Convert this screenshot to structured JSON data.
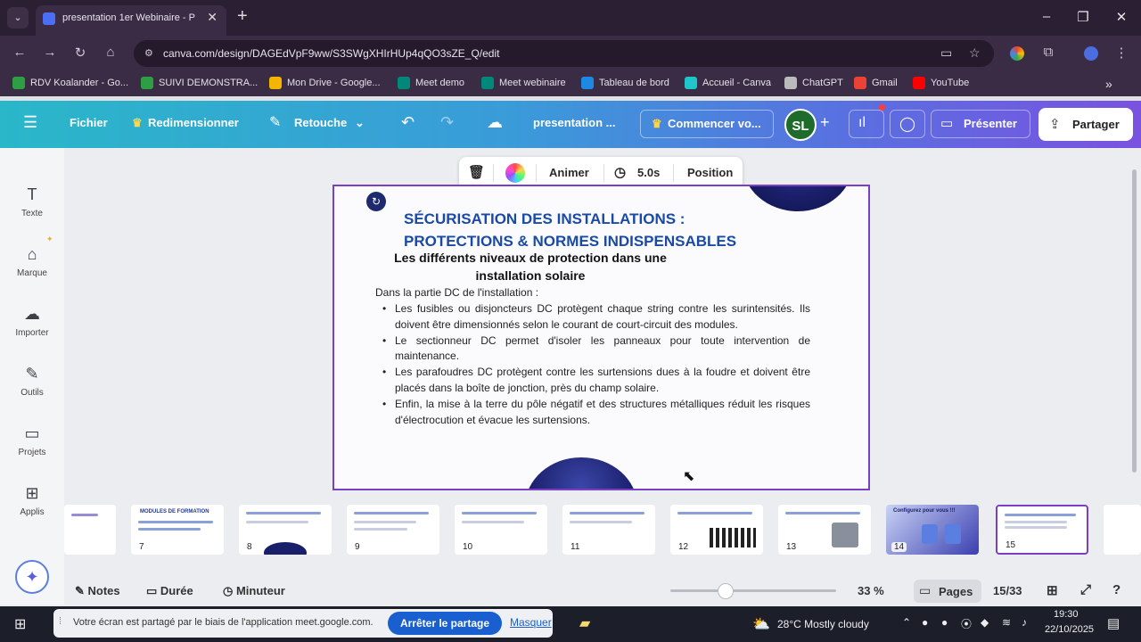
{
  "browser": {
    "tab_title": "presentation 1er Webinaire - P",
    "url": "canva.com/design/DAGEdVpF9ww/S3SWgXHIrHUp4qQO3sZE_Q/edit",
    "bookmarks": [
      {
        "label": "RDV Koalander - Go...",
        "color": "#2e9e44"
      },
      {
        "label": "SUIVI DEMONSTRA...",
        "color": "#2e9e44"
      },
      {
        "label": "Mon Drive - Google...",
        "color": "#f4b400"
      },
      {
        "label": "Meet demo",
        "color": "#00897b"
      },
      {
        "label": "Meet webinaire",
        "color": "#00897b"
      },
      {
        "label": "Tableau de bord",
        "color": "#1e88e5"
      },
      {
        "label": "Accueil - Canva",
        "color": "#20c4cb"
      },
      {
        "label": "ChatGPT",
        "color": "#bbbbbb"
      },
      {
        "label": "Gmail",
        "color": "#ea4335"
      },
      {
        "label": "YouTube",
        "color": "#ff0000"
      }
    ]
  },
  "canva_toolbar": {
    "menu_icon": "hamburger-icon",
    "file": "Fichier",
    "resize": "Redimensionner",
    "edit": "Retouche",
    "design_title": "presentation ...",
    "start": "Commencer vo...",
    "avatar_initials": "SL",
    "present": "Présenter",
    "share": "Partager"
  },
  "sidebar": {
    "items": [
      {
        "label": "Texte",
        "icon": "text-icon"
      },
      {
        "label": "Marque",
        "icon": "brand-icon"
      },
      {
        "label": "Importer",
        "icon": "upload-icon"
      },
      {
        "label": "Outils",
        "icon": "tools-icon"
      },
      {
        "label": "Projets",
        "icon": "folder-icon"
      },
      {
        "label": "Applis",
        "icon": "apps-icon"
      }
    ]
  },
  "context_toolbar": {
    "animate": "Animer",
    "duration": "5.0s",
    "position": "Position"
  },
  "slide": {
    "title_line1": "SÉCURISATION DES INSTALLATIONS :",
    "title_line2": "PROTECTIONS & NORMES INDISPENSABLES",
    "subtitle_line1": "Les différents niveaux de protection dans une",
    "subtitle_line2": "installation solaire",
    "intro": "Dans la partie DC de l'installation :",
    "bullets": [
      "Les fusibles ou disjoncteurs DC protègent chaque string contre les surintensités. Ils doivent être dimensionnés selon le courant de court-circuit des modules.",
      "Le sectionneur DC permet d'isoler les panneaux pour toute intervention de maintenance.",
      "Les parafoudres DC protègent contre les surtensions dues à la foudre et doivent être placés dans la boîte de jonction, près du champ solaire.",
      "Enfin, la mise à la terre du pôle négatif et des structures métalliques réduit les risques d'électrocution et évacue les surtensions."
    ]
  },
  "thumbnails": [
    {
      "num": ""
    },
    {
      "num": "7",
      "title": "MODULES DE FORMATION"
    },
    {
      "num": "8"
    },
    {
      "num": "9"
    },
    {
      "num": "10"
    },
    {
      "num": "11"
    },
    {
      "num": "12"
    },
    {
      "num": "13"
    },
    {
      "num": "14",
      "title": "Configurez pour vous !!!"
    },
    {
      "num": "15"
    }
  ],
  "bottom": {
    "notes": "Notes",
    "duration": "Durée",
    "timer": "Minuteur",
    "zoom": "33 %",
    "zoom_level": 0.33,
    "pages": "Pages",
    "page_count": "15/33"
  },
  "taskbar": {
    "share_notice": "Votre écran est partagé par le biais de l'application meet.google.com.",
    "stop_sharing": "Arrêter le partage",
    "hide": "Masquer",
    "weather": "28°C  Mostly cloudy",
    "time": "19:30",
    "date": "22/10/2025"
  }
}
